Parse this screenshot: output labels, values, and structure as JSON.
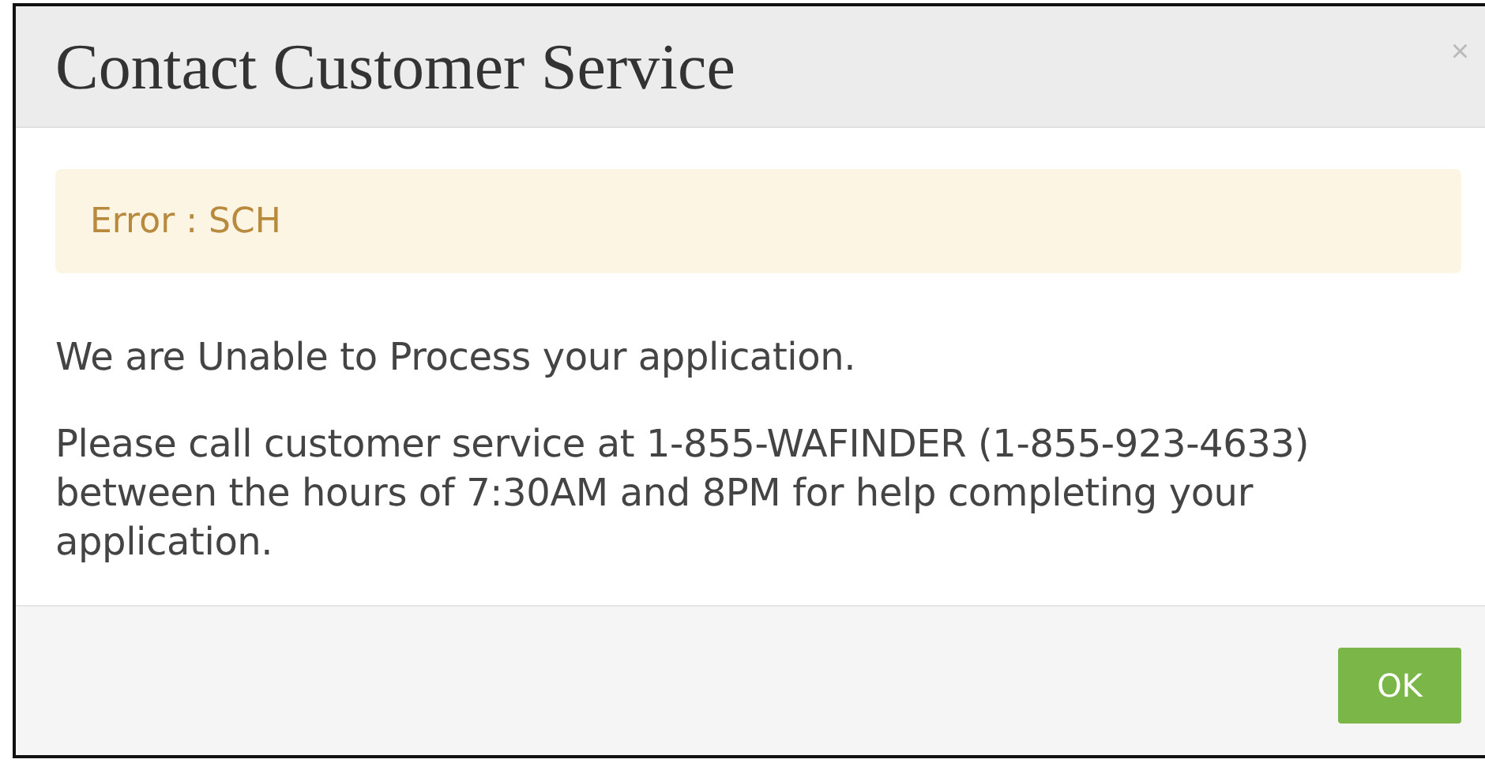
{
  "dialog": {
    "title": "Contact Customer Service",
    "close": "×",
    "alert": {
      "text": "Error : SCH"
    },
    "paragraphs": [
      "We are Unable to Process your application.",
      "Please call customer service at 1-855-WAFINDER (1-855-923-4633) between the hours of 7:30AM and 8PM for help completing your application."
    ],
    "buttons": [
      "OK"
    ]
  }
}
